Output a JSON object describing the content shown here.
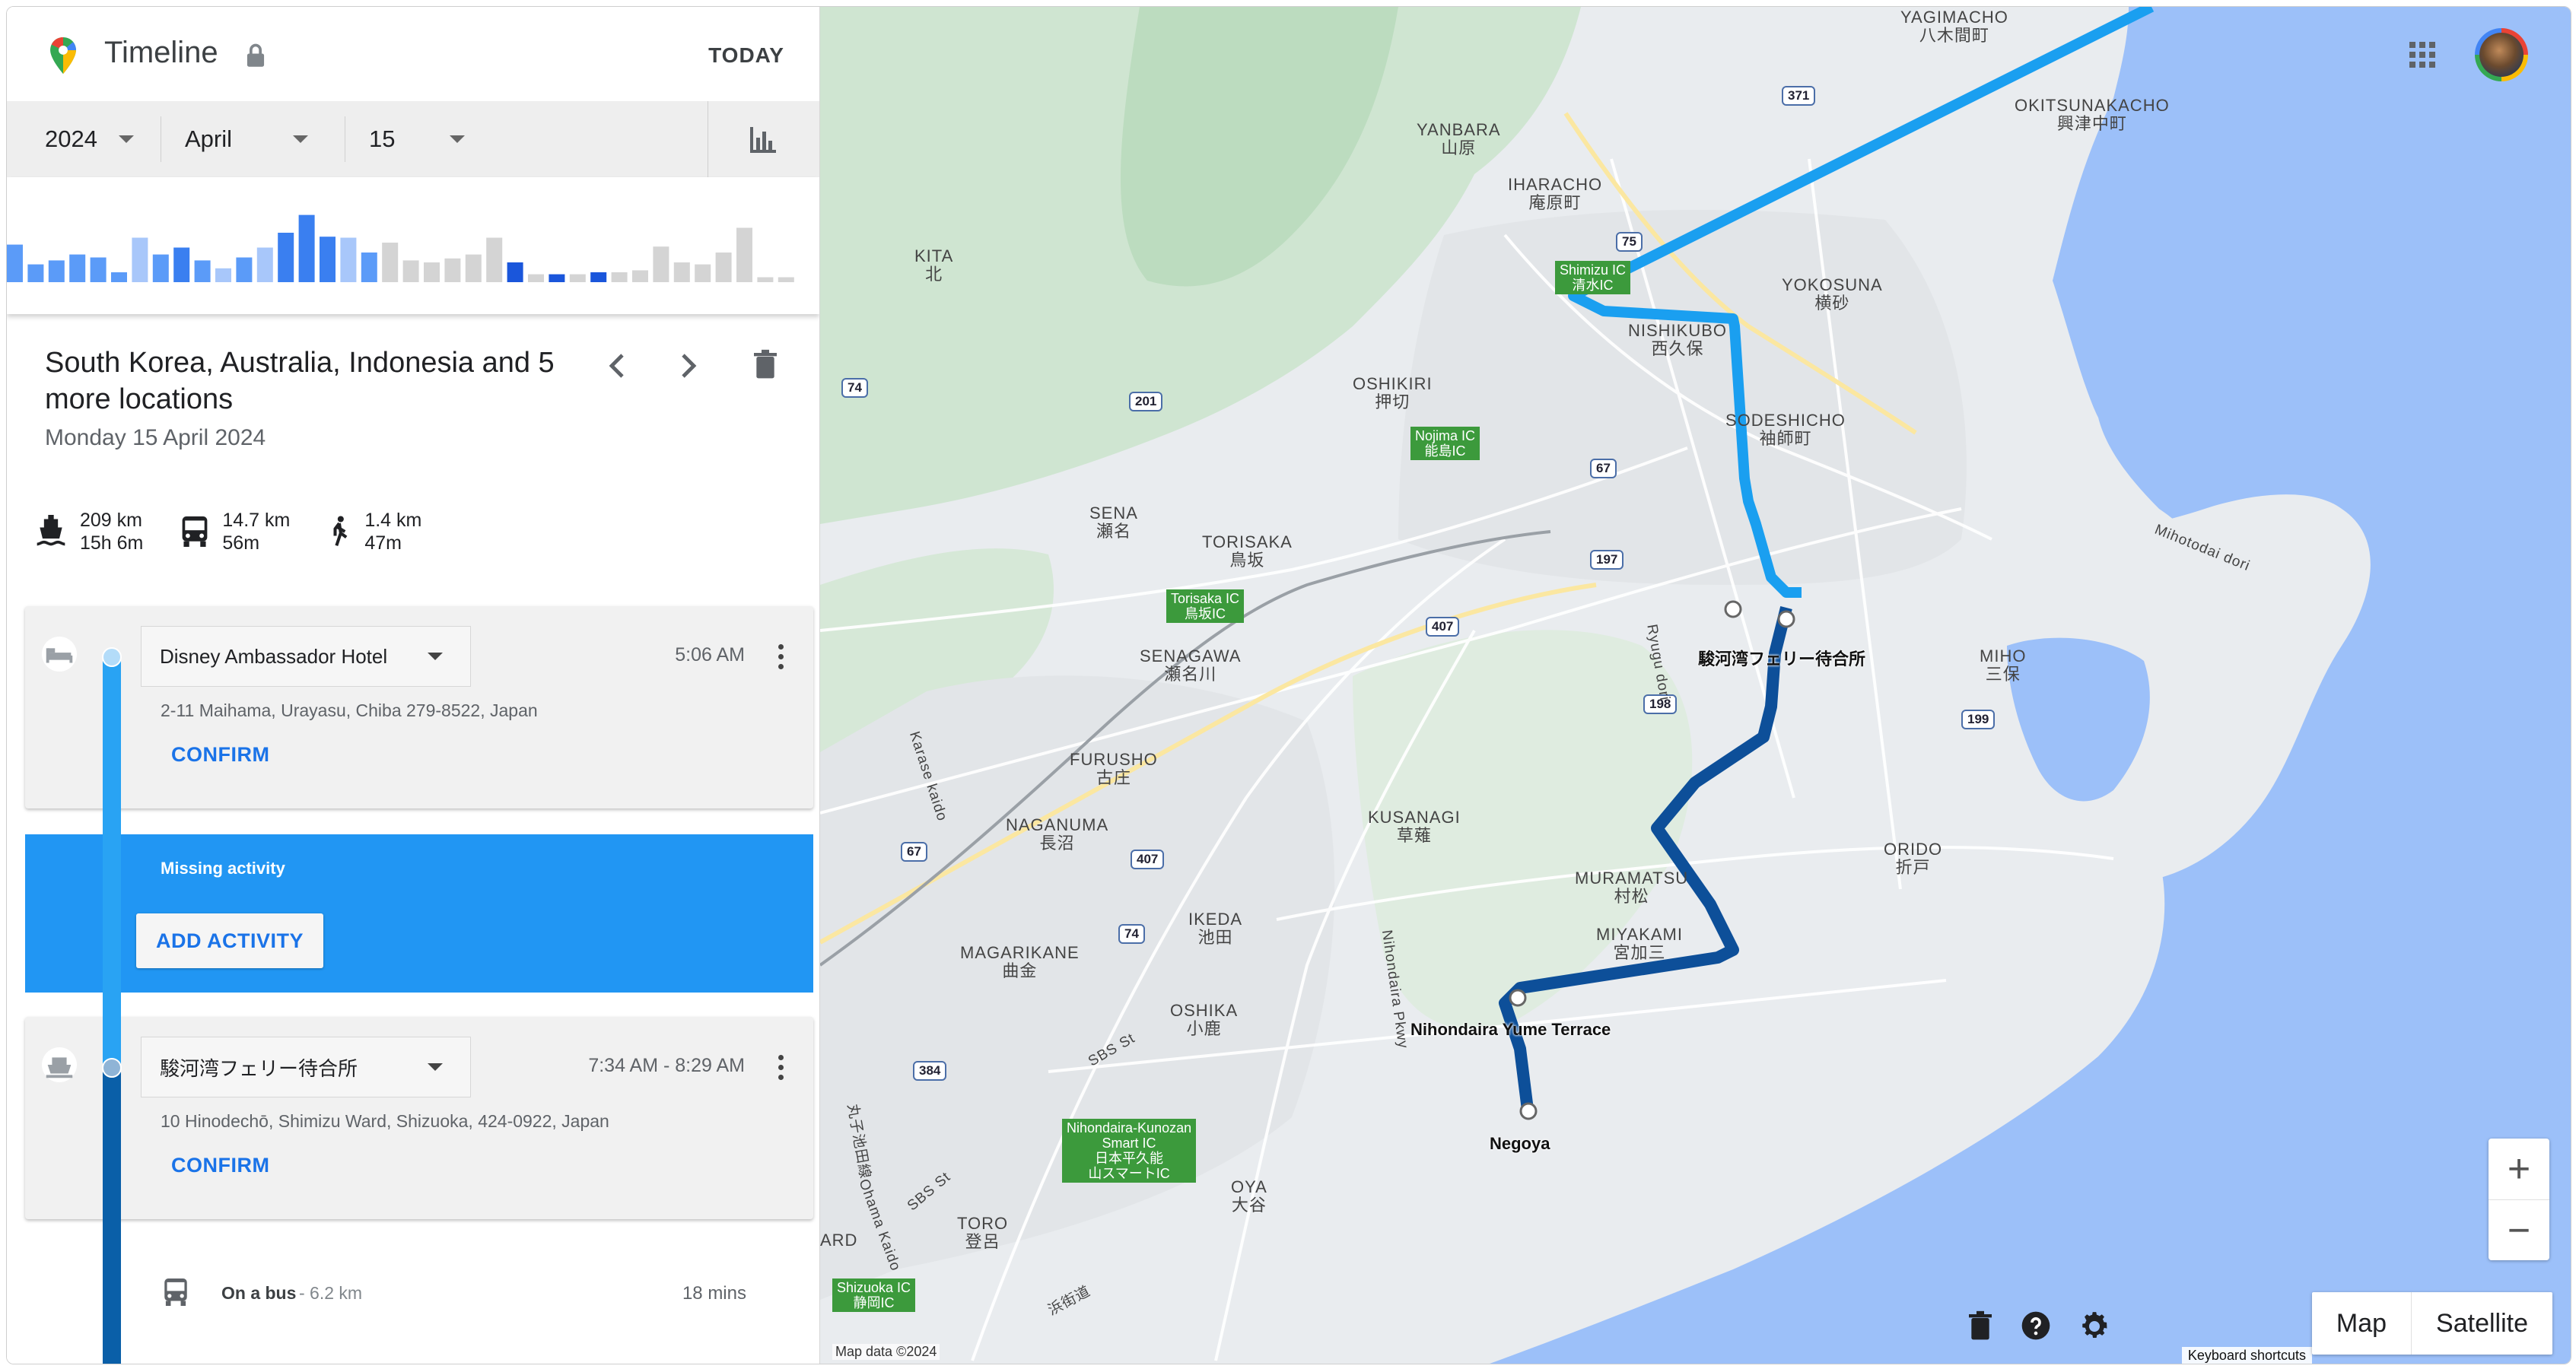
{
  "header": {
    "title": "Timeline",
    "today_label": "TODAY"
  },
  "date_picker": {
    "year": "2024",
    "month": "April",
    "day": "15"
  },
  "histogram": {
    "values": [
      0.38,
      0.18,
      0.22,
      0.28,
      0.25,
      0.1,
      0.45,
      0.28,
      0.35,
      0.22,
      0.14,
      0.25,
      0.35,
      0.5,
      0.68,
      0.46,
      0.45,
      0.3,
      0.4,
      0.22,
      0.2,
      0.24,
      0.28,
      0.45,
      0.2,
      0.08,
      0.08,
      0.08,
      0.1,
      0.1,
      0.12,
      0.36,
      0.2,
      0.18,
      0.3,
      0.55,
      0.05,
      0.05
    ],
    "highlight_colors": [
      "#5b9bf8",
      "#a8c7fa",
      "#1a56db",
      "#d4d4d4"
    ]
  },
  "trip": {
    "title": "South Korea, Australia, Indonesia and 5 more locations",
    "date": "Monday 15 April 2024"
  },
  "stats": [
    {
      "icon": "ferry-icon",
      "distance": "209 km",
      "duration": "15h 6m"
    },
    {
      "icon": "bus-icon",
      "distance": "14.7 km",
      "duration": "56m"
    },
    {
      "icon": "walk-icon",
      "distance": "1.4 km",
      "duration": "47m"
    }
  ],
  "places": [
    {
      "name": "Disney Ambassador Hotel",
      "time": "5:06 AM",
      "address": "2-11 Maihama, Urayasu, Chiba 279-8522, Japan",
      "confirm": "CONFIRM",
      "icon": "hotel-icon"
    },
    {
      "name": "駿河湾フェリー待合所",
      "time": "7:34 AM - 8:29 AM",
      "address": "10 Hinodechō, Shimizu Ward, Shizuoka, 424-0922, Japan",
      "confirm": "CONFIRM",
      "icon": "ferry-terminal-icon"
    }
  ],
  "missing": {
    "label": "Missing activity",
    "button": "ADD ACTIVITY"
  },
  "activity": {
    "mode": "On a bus",
    "distance": "- 6.2 km",
    "duration": "18 mins"
  },
  "map": {
    "labels": [
      {
        "t1": "YAGIMACHO",
        "t2": "八木間町"
      },
      {
        "t1": "OKITSUNAKACHO",
        "t2": "興津中町"
      },
      {
        "t1": "YANBARA",
        "t2": "山原"
      },
      {
        "t1": "IHARACHO",
        "t2": "庵原町"
      },
      {
        "t1": "KITA",
        "t2": "北"
      },
      {
        "t1": "YOKOSUNA",
        "t2": "横砂"
      },
      {
        "t1": "NISHIKUBO",
        "t2": "西久保"
      },
      {
        "t1": "OSHIKIRI",
        "t2": "押切"
      },
      {
        "t1": "SODESHICHO",
        "t2": "袖師町"
      },
      {
        "t1": "SENA",
        "t2": "瀬名"
      },
      {
        "t1": "TORISAKA",
        "t2": "鳥坂"
      },
      {
        "t1": "SENAGAWA",
        "t2": "瀬名川"
      },
      {
        "t1": "MIHO",
        "t2": "三保"
      },
      {
        "t1": "FURUSHO",
        "t2": "古庄"
      },
      {
        "t1": "NAGANUMA",
        "t2": "長沼"
      },
      {
        "t1": "KUSANAGI",
        "t2": "草薙"
      },
      {
        "t1": "ORIDO",
        "t2": "折戸"
      },
      {
        "t1": "MURAMATSU",
        "t2": "村松"
      },
      {
        "t1": "IKEDA",
        "t2": "池田"
      },
      {
        "t1": "MIYAKAMI",
        "t2": "宮加三"
      },
      {
        "t1": "MAGARIKANE",
        "t2": "曲金"
      },
      {
        "t1": "OSHIKA",
        "t2": "小鹿"
      },
      {
        "t1": "OYA",
        "t2": "大谷"
      },
      {
        "t1": "TORO",
        "t2": "登呂"
      },
      {
        "t1": "ARD",
        "t2": ""
      }
    ],
    "ic_labels": [
      {
        "l1": "Shimizu IC",
        "l2": "清水IC"
      },
      {
        "l1": "Nojima IC",
        "l2": "能島IC"
      },
      {
        "l1": "Torisaka IC",
        "l2": "鳥坂IC"
      },
      {
        "l1": "Nihondaira-Kunozan",
        "l2": "Smart IC",
        "l3": "日本平久能",
        "l4": "山スマートIC"
      },
      {
        "l1": "Shizuoka IC",
        "l2": "静岡IC"
      }
    ],
    "route_shields": [
      "371",
      "75",
      "74",
      "201",
      "67",
      "197",
      "407",
      "198",
      "199",
      "407",
      "67",
      "74",
      "384"
    ],
    "streets": [
      "Ryugu dori",
      "Mihotodai dori",
      "Karase kaido",
      "Nihondaira Pkwy",
      "SBS St",
      "SBS St",
      "丸子池田線",
      "Ohama Kaido",
      "浜街道"
    ],
    "poi": {
      "ferry": "駿河湾フェリー待合所",
      "terrace": "Nihondaira Yume Terrace",
      "negoya": "Negoya"
    },
    "attribution": "Map data ©2024",
    "shortcuts": "Keyboard shortcuts",
    "map_type": [
      "Map",
      "Satellite"
    ],
    "zoom": [
      "+",
      "−"
    ]
  }
}
